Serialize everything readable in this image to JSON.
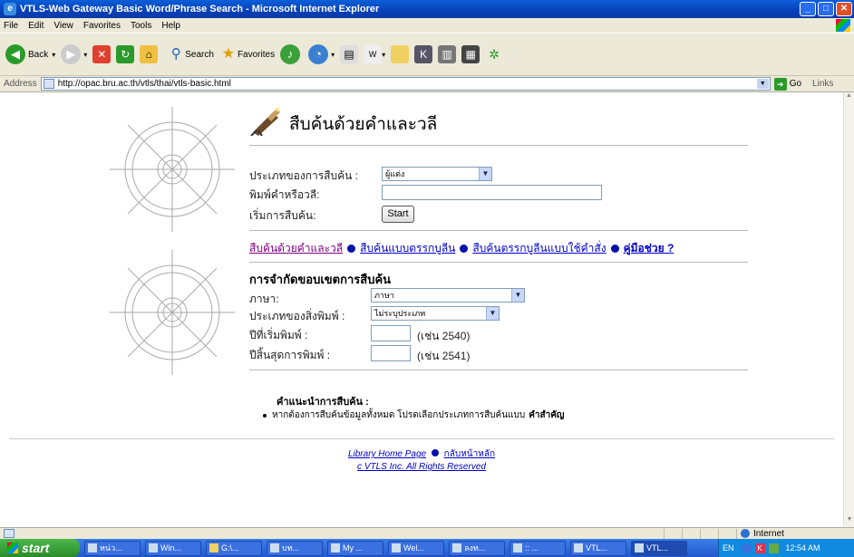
{
  "window": {
    "title": "VTLS-Web Gateway Basic Word/Phrase Search - Microsoft Internet Explorer"
  },
  "menu": [
    "File",
    "Edit",
    "View",
    "Favorites",
    "Tools",
    "Help"
  ],
  "toolbar": {
    "back": "Back",
    "search": "Search",
    "favorites": "Favorites"
  },
  "address": {
    "label": "Address",
    "url": "http://opac.bru.ac.th/vtls/thai/vtls-basic.html",
    "go": "Go",
    "links": "Links"
  },
  "page": {
    "heading": "สืบค้นด้วยคำและวลี",
    "search_type_label": "ประเภทของการสืบค้น :",
    "search_type_value": "ผู้แต่ง",
    "word_label": "พิมพ์คำหรือวลี:",
    "start_label": "เริ่มการสืบค้น:",
    "start_button": "Start",
    "nav": [
      {
        "label": "สืบค้นด้วยคำและวลี",
        "visited": true,
        "bold": false
      },
      {
        "label": "สืบค้นแบบตรรกบูลีน",
        "visited": false,
        "bold": false
      },
      {
        "label": "สืบค้นตรรกบูลีนแบบใช้คำสั่ง",
        "visited": false,
        "bold": false
      },
      {
        "label": "คู่มือช่วย ?",
        "visited": false,
        "bold": true
      }
    ],
    "limit_heading": "การจำกัดขอบเขตการสืบค้น",
    "language_label": "ภาษา:",
    "language_value": "ภาษา",
    "media_label": "ประเภทของสิ่งพิมพ์ :",
    "media_value": "ไม่ระบุประเภท",
    "year_start_label": "ปีที่เริ่มพิมพ์ :",
    "year_start_hint": "(เช่น 2540)",
    "year_end_label": "ปีสิ้นสุดการพิมพ์ :",
    "year_end_hint": "(เช่น 2541)",
    "advice_title": "คำแนะนำการสืบค้น :",
    "advice_text": "หากต้องการสืบค้นข้อมูลทั้งหมด โปรดเลือกประเภทการสืบค้นแบบ",
    "advice_bold": "คำสำคัญ",
    "footer_home": "Library Home Page",
    "footer_back": "กลับหน้าหลัก",
    "footer_copy": "c VTLS Inc. All Rights Reserved"
  },
  "status": {
    "zone": "Internet"
  },
  "taskbar": {
    "start": "start",
    "tasks": [
      "หน่ว...",
      "Win...",
      "G:\\...",
      "บท...",
      "My ...",
      "Wel...",
      "ลงท...",
      ":: ...",
      "VTL...",
      "VTL..."
    ],
    "lang": "EN",
    "clock": "12:54 AM"
  }
}
